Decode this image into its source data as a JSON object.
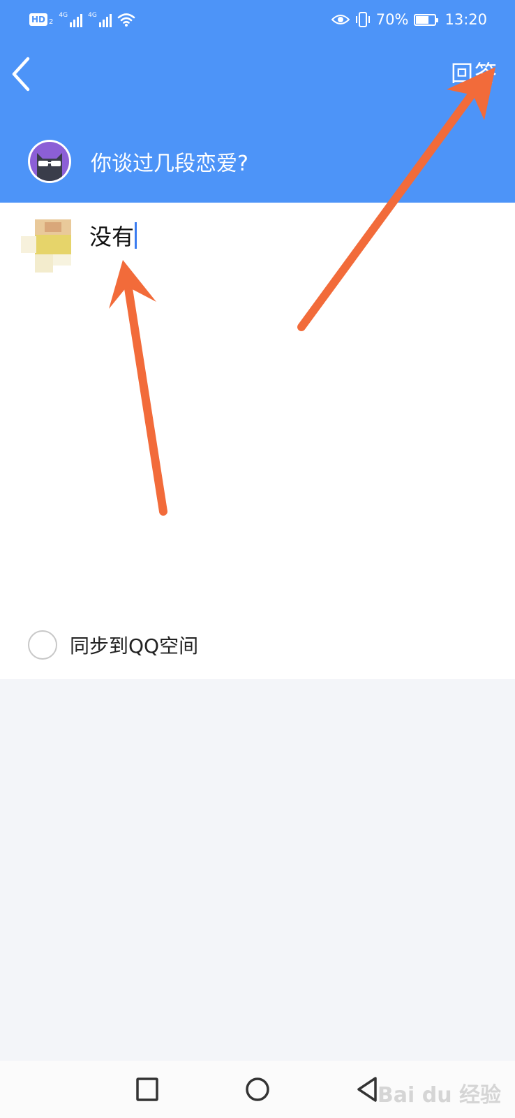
{
  "status_bar": {
    "hd_label": "HD",
    "hd_sub": "2",
    "network_1": "4G",
    "network_2": "4G",
    "battery_percent": "70%",
    "battery_level": 0.7,
    "time": "13:20",
    "icons": [
      "hd-icon",
      "signal-icon",
      "signal-icon",
      "wifi-icon",
      "eye-icon",
      "vibrate-icon",
      "battery-icon"
    ]
  },
  "header": {
    "answer_label": "回答",
    "question": "你谈过几段恋爱?",
    "color": "#4d94f8"
  },
  "answer": {
    "text": "没有"
  },
  "sync": {
    "label": "同步到QQ空间"
  },
  "nav": {
    "icons": [
      "recent-apps-icon",
      "home-icon",
      "back-icon"
    ]
  },
  "watermark": {
    "text": "Bai du 经验"
  },
  "annotation_color": "#f26b3a"
}
